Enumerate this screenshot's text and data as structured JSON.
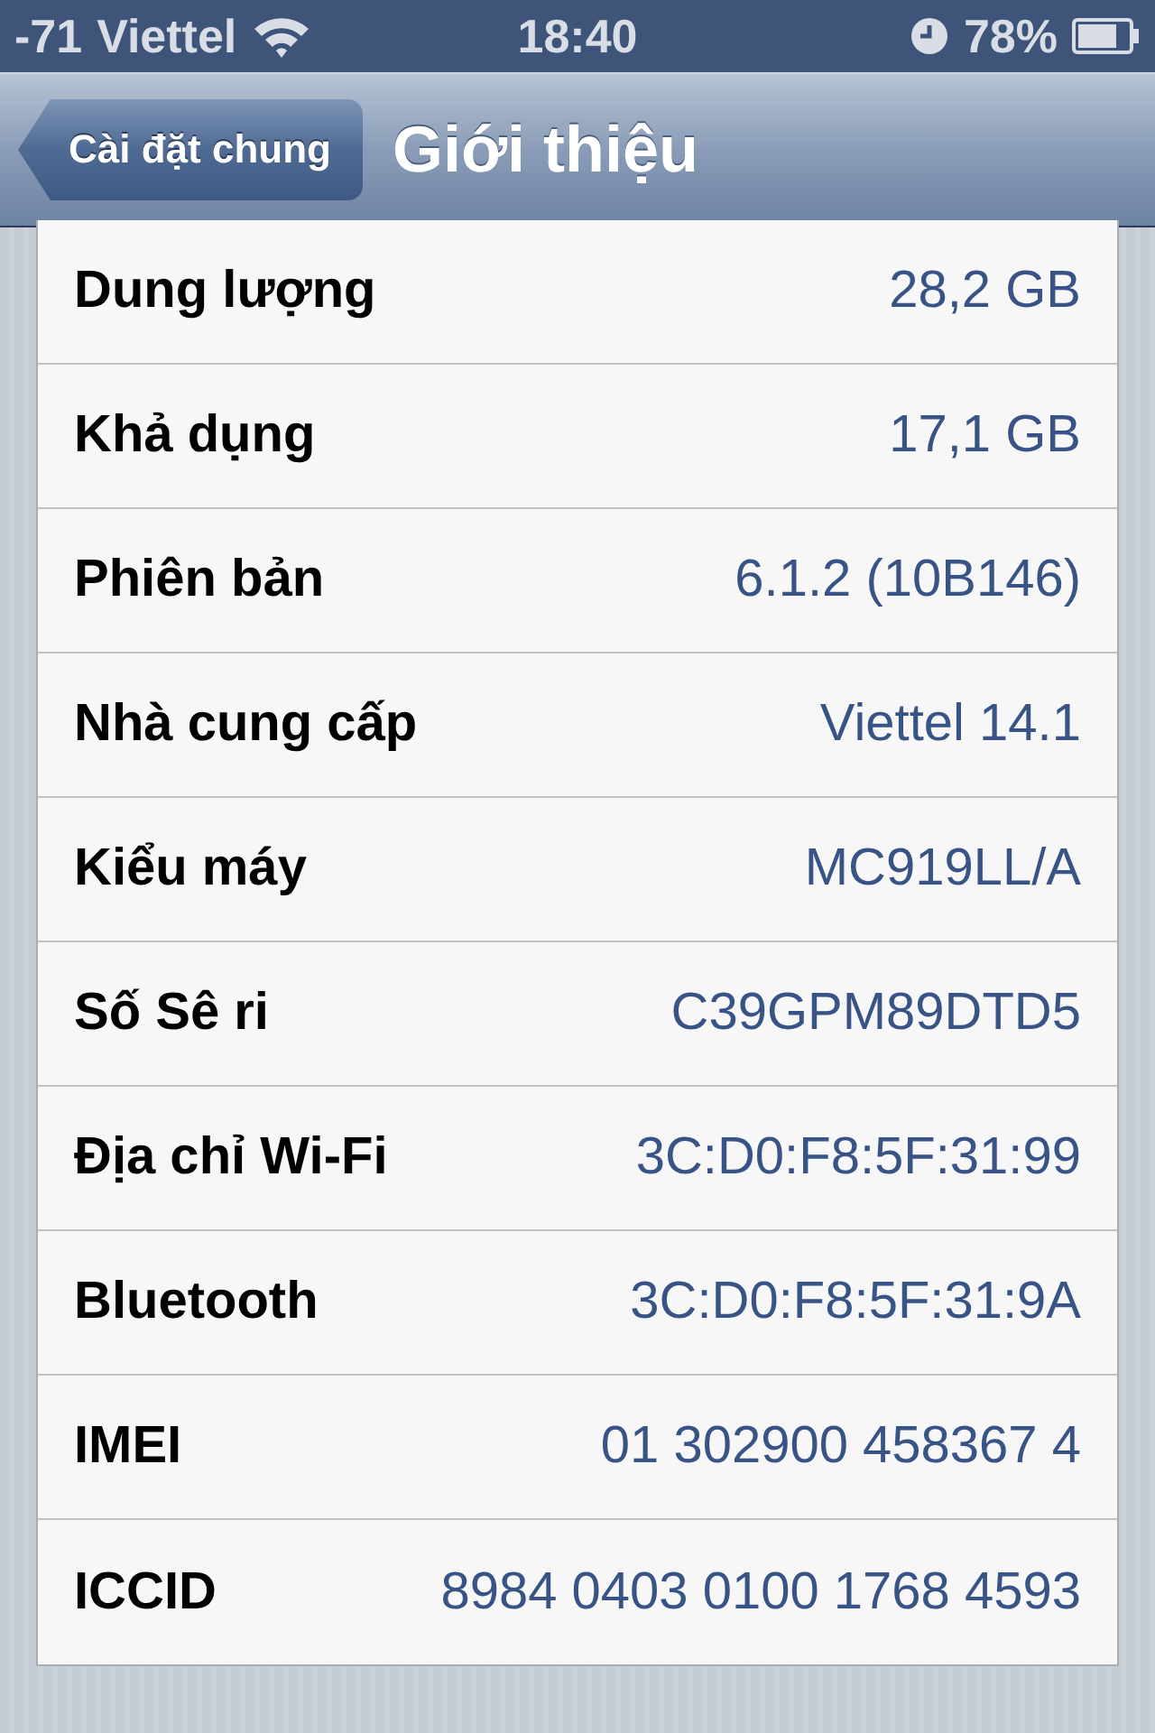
{
  "status_bar": {
    "signal": "-71",
    "carrier": "Viettel",
    "time": "18:40",
    "battery": "78%"
  },
  "nav_bar": {
    "back_button": "Cài đặt chung",
    "title": "Giới thiệu"
  },
  "rows": [
    {
      "label": "Dung lượng",
      "value": "28,2 GB"
    },
    {
      "label": "Khả dụng",
      "value": "17,1 GB"
    },
    {
      "label": "Phiên bản",
      "value": "6.1.2 (10B146)"
    },
    {
      "label": "Nhà cung cấp",
      "value": "Viettel 14.1"
    },
    {
      "label": "Kiểu máy",
      "value": "MC919LL/A"
    },
    {
      "label": "Số Sê ri",
      "value": "C39GPM89DTD5"
    },
    {
      "label": "Địa chỉ Wi-Fi",
      "value": "3C:D0:F8:5F:31:99"
    },
    {
      "label": "Bluetooth",
      "value": "3C:D0:F8:5F:31:9A"
    },
    {
      "label": "IMEI",
      "value": "01 302900 458367 4"
    },
    {
      "label": "ICCID",
      "value": "8984 0403 0100 1768 4593"
    }
  ]
}
